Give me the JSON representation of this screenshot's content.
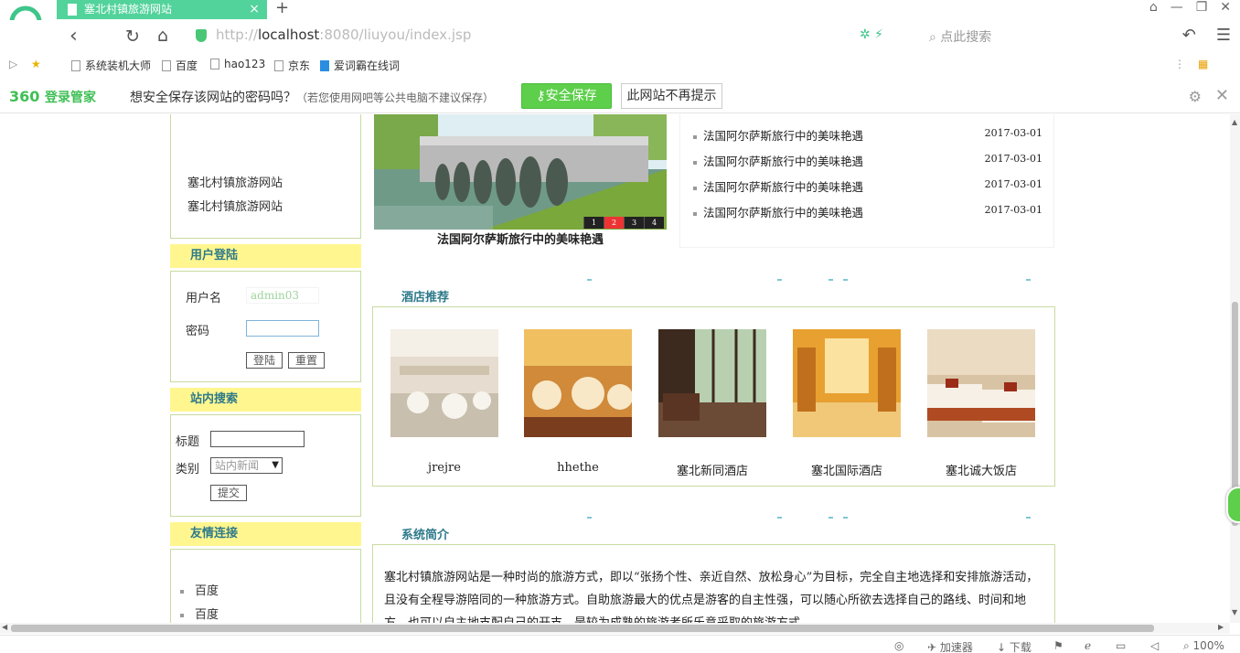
{
  "browser": {
    "tab_title": "塞北村镇旅游网站",
    "tab_close": "×",
    "new_tab": "+",
    "url_host": "localhost",
    "url_prefix": "http://",
    "url_rest": ":8080/liuyou/index.jsp",
    "search_placeholder": "点此搜索",
    "bookmarks": [
      "系统装机大师",
      "百度",
      "hao123",
      "京东",
      "爱词霸在线词"
    ]
  },
  "password_bar": {
    "brand": "360",
    "brand_sub": "登录管家",
    "message": "想安全保存该网站的密码吗？",
    "note": "（若您使用网吧等公共电脑不建议保存）",
    "save_label": "安全保存",
    "never_label": "此网站不再提示"
  },
  "sidebar": {
    "site_links": [
      "塞北村镇旅游网站",
      "塞北村镇旅游网站"
    ],
    "login": {
      "header": "用户登陆",
      "username_label": "用户名",
      "username_value": "admin03",
      "password_label": "密码",
      "login_button": "登陆",
      "reset_button": "重置"
    },
    "search": {
      "header": "站内搜索",
      "title_label": "标题",
      "category_label": "类别",
      "category_value": "站内新闻",
      "submit_button": "提交"
    },
    "links": {
      "header": "友情连接",
      "items": [
        "百度",
        "百度"
      ]
    }
  },
  "slideshow": {
    "caption": "法国阿尔萨斯旅行中的美味艳遇",
    "pages": [
      "1",
      "2",
      "3",
      "4"
    ],
    "active_page": "2"
  },
  "news": [
    {
      "title": "法国阿尔萨斯旅行中的美味艳遇",
      "date": "2017-03-01"
    },
    {
      "title": "法国阿尔萨斯旅行中的美味艳遇",
      "date": "2017-03-01"
    },
    {
      "title": "法国阿尔萨斯旅行中的美味艳遇",
      "date": "2017-03-01"
    },
    {
      "title": "法国阿尔萨斯旅行中的美味艳遇",
      "date": "2017-03-01"
    }
  ],
  "hotels": {
    "title": "酒店推荐",
    "items": [
      {
        "name": "jrejre"
      },
      {
        "name": "hhethe"
      },
      {
        "name": "塞北新同酒店"
      },
      {
        "name": "塞北国际酒店"
      },
      {
        "name": "塞北诚大饭店"
      }
    ]
  },
  "intro": {
    "title": "系统简介",
    "text": "塞北村镇旅游网站是一种时尚的旅游方式，即以“张扬个性、亲近自然、放松身心”为目标，完全自主地选择和安排旅游活动，且没有全程导游陪同的一种旅游方式。自助旅游最大的优点是游客的自主性强，可以随心所欲去选择自己的路线、时间和地方，也可以自主地支配自己的开支，是较为成熟的旅游者所乐意采取的旅游方式。"
  },
  "statusbar": {
    "accelerator": "加速器",
    "download": "下载",
    "zoom": "100%"
  }
}
